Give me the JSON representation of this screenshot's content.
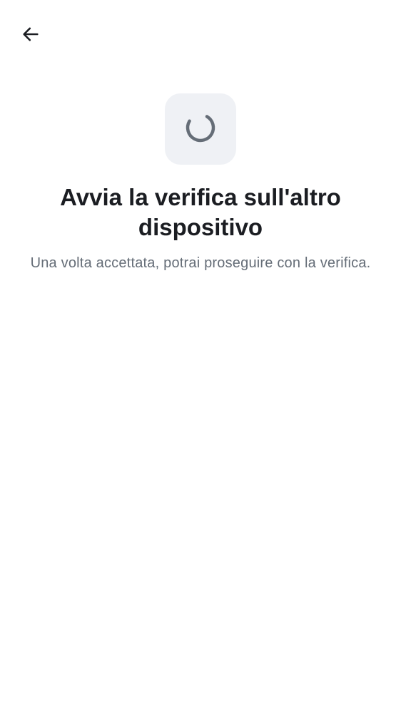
{
  "navigation": {
    "back_icon": "arrow-left-icon"
  },
  "status": {
    "spinner_icon": "loading-spinner-icon",
    "tile_color": "#eff1f5",
    "spinner_color": "#656d77"
  },
  "content": {
    "title": "Avvia la verifica sull'altro dispositivo",
    "subtitle": "Una volta accettata, potrai proseguire con la verifica."
  }
}
